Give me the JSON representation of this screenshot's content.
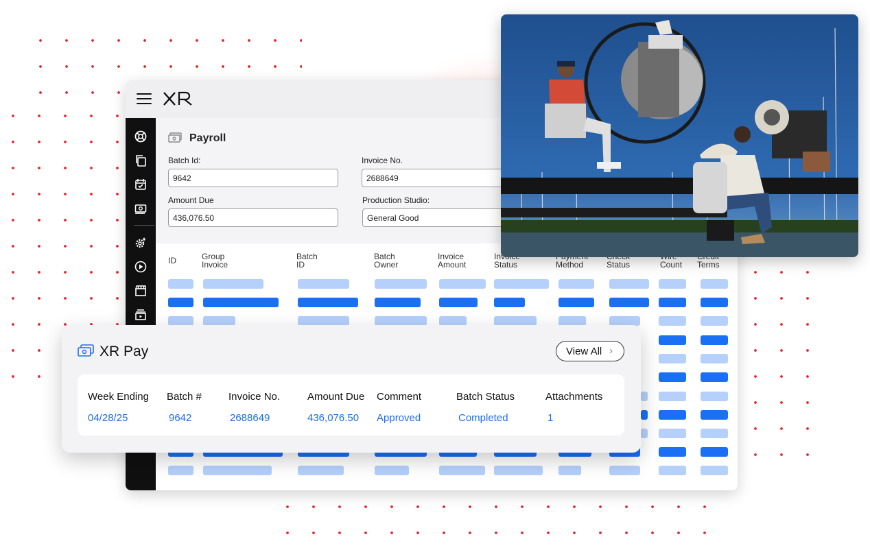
{
  "app": {
    "brand": "XR",
    "sidebar_icons": [
      "support-icon",
      "copy-icon",
      "calendar-check-icon",
      "payroll-icon",
      "settings-gear-icon",
      "play-circle-icon",
      "clapperboard-icon",
      "media-library-icon"
    ]
  },
  "payroll": {
    "title": "Payroll",
    "fields": {
      "batch_id": {
        "label": "Batch Id:",
        "value": "9642"
      },
      "invoice_no": {
        "label": "Invoice No.",
        "value": "2688649"
      },
      "amount_due": {
        "label": "Amount Due",
        "value": "436,076.50"
      },
      "production_studio": {
        "label": "Production Studio:",
        "value": "General Good"
      }
    },
    "table_headers": [
      [
        "ID"
      ],
      [
        "Group",
        "Invoice"
      ],
      [
        "Batch",
        "ID"
      ],
      [
        "Batch",
        "Owner"
      ],
      [
        "Invoice",
        "Amount"
      ],
      [
        "Invoice",
        "Status"
      ],
      [
        "Payment",
        "Method"
      ],
      [
        "Check",
        "Status"
      ],
      [
        "Wire",
        "Count"
      ],
      [
        "Credit",
        "Terms"
      ]
    ]
  },
  "xr_pay": {
    "title": "XR Pay",
    "view_all": "View All",
    "columns": [
      "Week Ending",
      "Batch #",
      "Invoice No.",
      "Amount Due",
      "Comment",
      "Batch Status",
      "Attachments"
    ],
    "row": [
      "04/28/25",
      "9642",
      "2688649",
      "436,076.50",
      "Approved",
      "Completed",
      "1"
    ]
  },
  "colors": {
    "accent": "#1a6ff4",
    "accent_light": "#b4d0fb",
    "dots": "#e8202a",
    "sidebar": "#101010"
  }
}
